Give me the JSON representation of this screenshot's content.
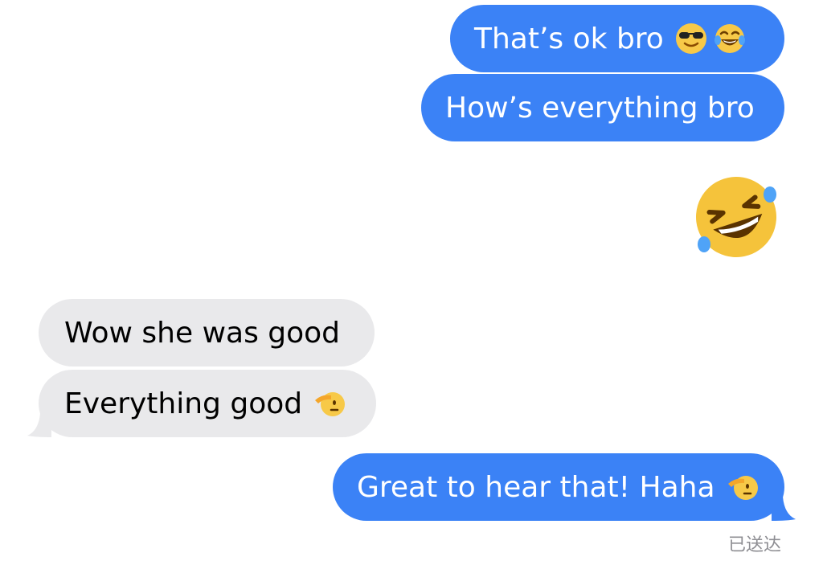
{
  "conversation": {
    "messages": [
      {
        "id": "m1",
        "side": "sent",
        "text": "That’s ok bro",
        "emojis": [
          "smiling-face-with-sunglasses",
          "face-with-tears-of-joy"
        ]
      },
      {
        "id": "m2",
        "side": "sent",
        "text": "How’s everything bro"
      },
      {
        "id": "m3",
        "side": "sent",
        "big_emoji": "rolling-on-the-floor-laughing"
      },
      {
        "id": "m4",
        "side": "received",
        "text": "Wow she was good"
      },
      {
        "id": "m5",
        "side": "received",
        "text": "Everything good",
        "emojis": [
          "saluting-face"
        ]
      },
      {
        "id": "m6",
        "side": "sent",
        "text": "Great to hear that! Haha",
        "emojis": [
          "saluting-face"
        ]
      }
    ],
    "delivery_status": "已送达"
  },
  "colors": {
    "sent_bubble": "#3b82f6",
    "received_bubble": "#e9e9eb",
    "sent_text": "#ffffff",
    "received_text": "#000000",
    "status_text": "#8e8e93"
  }
}
